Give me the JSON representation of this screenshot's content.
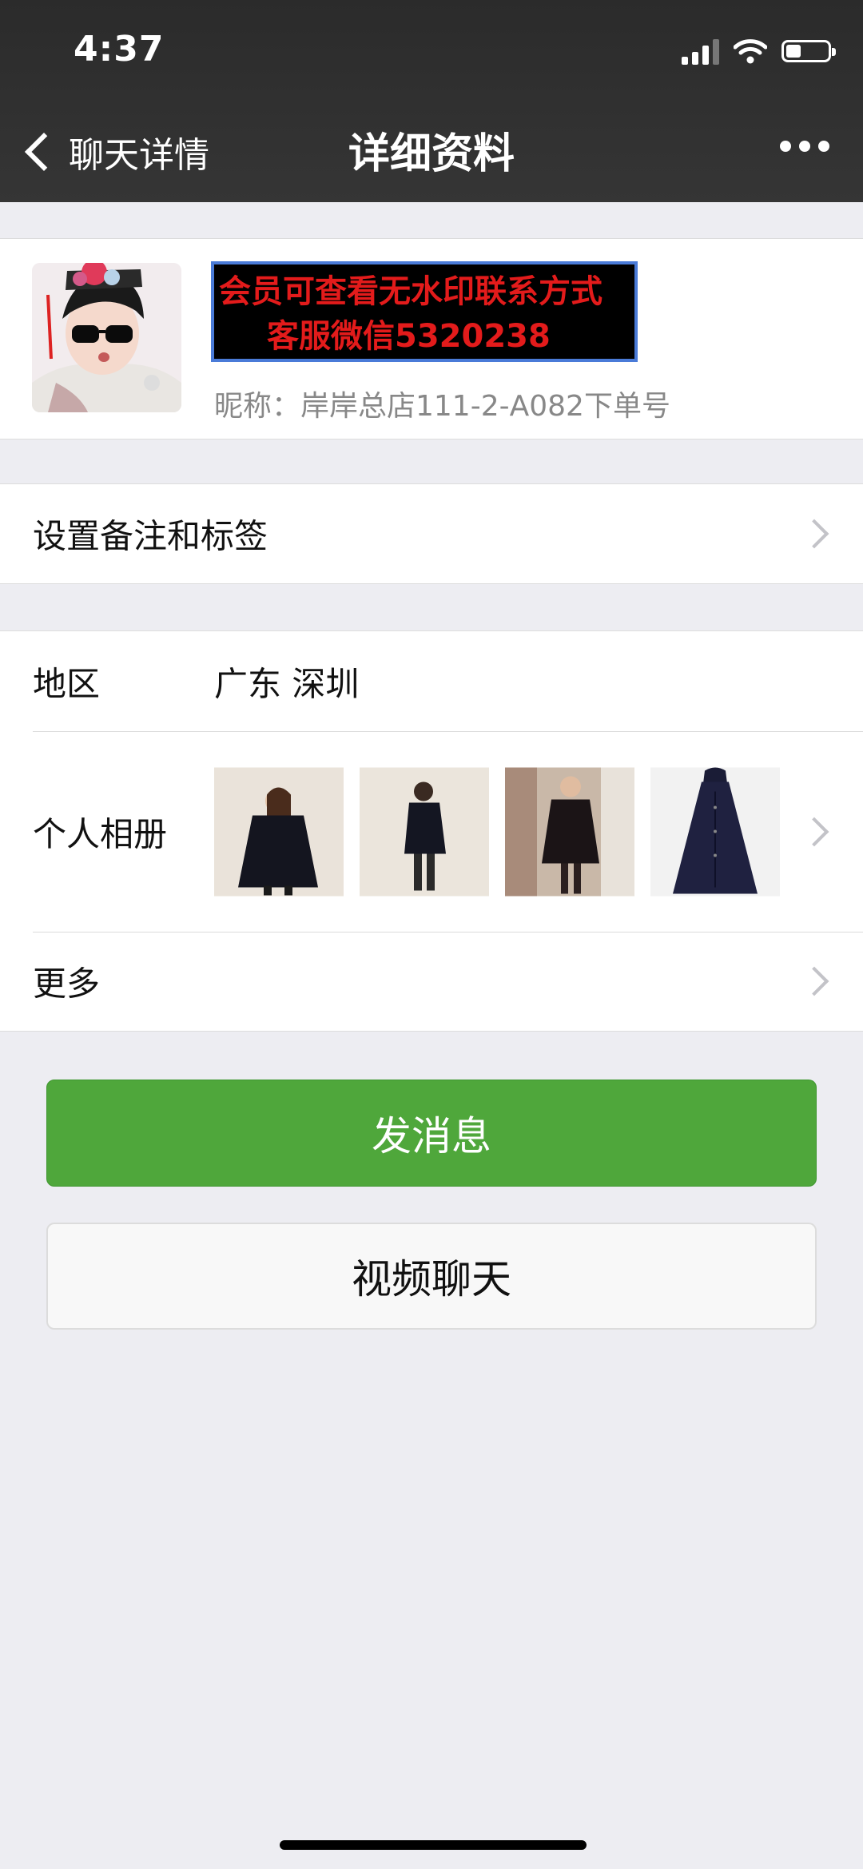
{
  "status_bar": {
    "time": "4:37"
  },
  "nav": {
    "back_label": "聊天详情",
    "title": "详细资料"
  },
  "profile": {
    "watermark_line1": "会员可查看无水印联系方式",
    "watermark_line2": "客服微信5320238",
    "nickname": "昵称：岸岸总店111-2-A082下单号"
  },
  "rows": {
    "remark_label": "设置备注和标签",
    "region_label": "地区",
    "region_value": "广东 深圳",
    "album_label": "个人相册",
    "more_label": "更多"
  },
  "buttons": {
    "message": "发消息",
    "video_call": "视频聊天"
  },
  "colors": {
    "primary_green": "#4fa73b",
    "nav_bg": "#2f2f2f",
    "page_bg": "#ededf2"
  }
}
